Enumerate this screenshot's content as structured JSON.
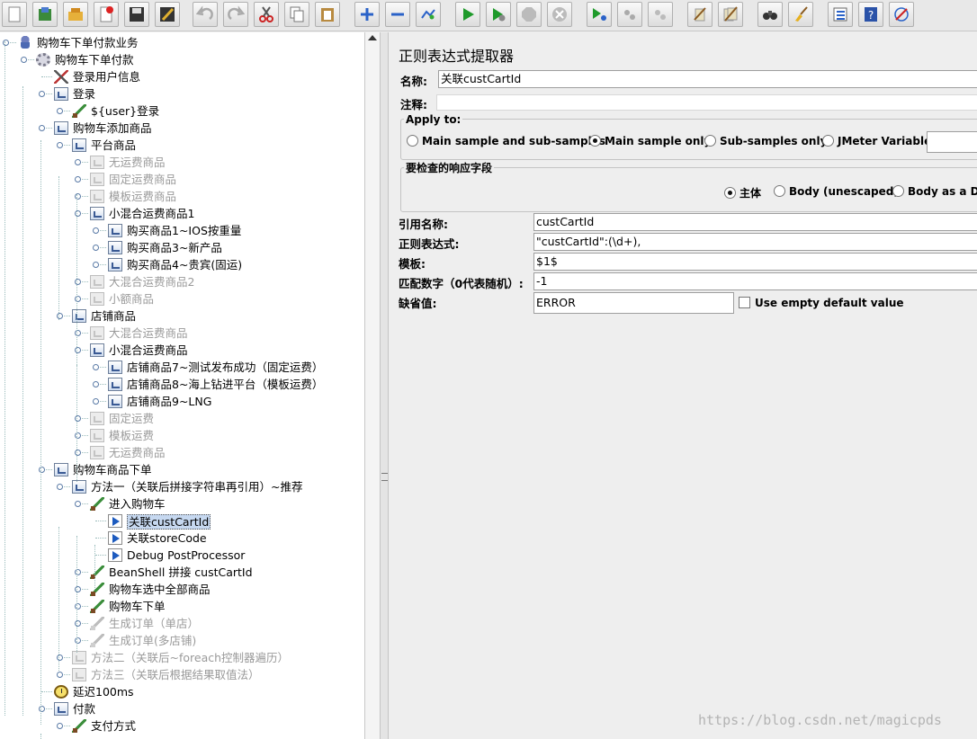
{
  "tree": {
    "nodes": [
      {
        "label": "购物车下单付款业务",
        "icon": "flask-icon",
        "state": "enabled"
      },
      {
        "label": "购物车下单付款",
        "icon": "gear-icon",
        "state": "enabled"
      },
      {
        "label": "登录用户信息",
        "icon": "tools-icon",
        "state": "enabled"
      },
      {
        "label": "登录",
        "icon": "transaction-icon",
        "state": "enabled"
      },
      {
        "label": "${user}登录",
        "icon": "sampler-icon",
        "state": "enabled"
      },
      {
        "label": "购物车添加商品",
        "icon": "transaction-icon",
        "state": "enabled"
      },
      {
        "label": "平台商品",
        "icon": "transaction-icon",
        "state": "enabled"
      },
      {
        "label": "无运费商品",
        "icon": "transaction-icon",
        "state": "disabled"
      },
      {
        "label": "固定运费商品",
        "icon": "transaction-icon",
        "state": "disabled"
      },
      {
        "label": "模板运费商品",
        "icon": "transaction-icon",
        "state": "disabled"
      },
      {
        "label": "小混合运费商品1",
        "icon": "transaction-icon",
        "state": "enabled"
      },
      {
        "label": "购买商品1~IOS按重量",
        "icon": "transaction-icon",
        "state": "enabled"
      },
      {
        "label": "购买商品3~新产品",
        "icon": "transaction-icon",
        "state": "enabled"
      },
      {
        "label": "购买商品4~贵宾(固运)",
        "icon": "transaction-icon",
        "state": "enabled"
      },
      {
        "label": "大混合运费商品2",
        "icon": "transaction-icon",
        "state": "disabled"
      },
      {
        "label": "小额商品",
        "icon": "transaction-icon",
        "state": "disabled"
      },
      {
        "label": "店铺商品",
        "icon": "transaction-icon",
        "state": "enabled"
      },
      {
        "label": "大混合运费商品",
        "icon": "transaction-icon",
        "state": "disabled"
      },
      {
        "label": "小混合运费商品",
        "icon": "transaction-icon",
        "state": "enabled"
      },
      {
        "label": "店铺商品7~测试发布成功（固定运费）",
        "icon": "transaction-icon",
        "state": "enabled"
      },
      {
        "label": "店铺商品8~海上钻进平台（模板运费）",
        "icon": "transaction-icon",
        "state": "enabled"
      },
      {
        "label": "店铺商品9~LNG",
        "icon": "transaction-icon",
        "state": "enabled"
      },
      {
        "label": "固定运费",
        "icon": "transaction-icon",
        "state": "disabled"
      },
      {
        "label": "模板运费",
        "icon": "transaction-icon",
        "state": "disabled"
      },
      {
        "label": "无运费商品",
        "icon": "transaction-icon",
        "state": "disabled"
      },
      {
        "label": "购物车商品下单",
        "icon": "transaction-icon",
        "state": "enabled"
      },
      {
        "label": "方法一（关联后拼接字符串再引用）~推荐",
        "icon": "transaction-icon",
        "state": "enabled"
      },
      {
        "label": "进入购物车",
        "icon": "sampler-icon",
        "state": "enabled"
      },
      {
        "label": "关联custCartId",
        "icon": "postprocessor-icon",
        "state": "selected"
      },
      {
        "label": "关联storeCode",
        "icon": "postprocessor-icon",
        "state": "enabled"
      },
      {
        "label": "Debug PostProcessor",
        "icon": "postprocessor-icon",
        "state": "enabled"
      },
      {
        "label": "BeanShell 拼接 custCartId",
        "icon": "sampler-icon",
        "state": "enabled"
      },
      {
        "label": "购物车选中全部商品",
        "icon": "sampler-icon",
        "state": "enabled"
      },
      {
        "label": "购物车下单",
        "icon": "sampler-icon",
        "state": "enabled"
      },
      {
        "label": "生成订单（单店）",
        "icon": "sampler-icon",
        "state": "disabled"
      },
      {
        "label": "生成订单(多店铺)",
        "icon": "sampler-icon",
        "state": "disabled"
      },
      {
        "label": "方法二（关联后~foreach控制器遍历）",
        "icon": "transaction-icon",
        "state": "disabled"
      },
      {
        "label": "方法三（关联后根据结果取值法）",
        "icon": "transaction-icon",
        "state": "disabled"
      },
      {
        "label": "延迟100ms",
        "icon": "timer-icon",
        "state": "enabled"
      },
      {
        "label": "付款",
        "icon": "transaction-icon",
        "state": "enabled"
      },
      {
        "label": "支付方式",
        "icon": "sampler-icon",
        "state": "enabled"
      }
    ]
  },
  "editor": {
    "title": "正则表达式提取器",
    "name_label": "名称:",
    "name_value": "关联custCartId",
    "comment_label": "注释:",
    "comment_value": "",
    "apply_to": {
      "title": "Apply to:",
      "options": [
        "Main sample and sub-samples",
        "Main sample only",
        "Sub-samples only",
        "JMeter Variable"
      ],
      "selected": "Main sample only",
      "variable_value": ""
    },
    "response_field": {
      "title": "要检查的响应字段",
      "options": [
        "主体",
        "Body (unescaped)",
        "Body as a Doc"
      ],
      "selected": "主体"
    },
    "ref_name_label": "引用名称:",
    "ref_name_value": "custCartId",
    "regex_label": "正则表达式:",
    "regex_value": "\"custCartId\":(\\d+),",
    "template_label": "模板:",
    "template_value": "$1$",
    "match_no_label": "匹配数字（0代表随机）:",
    "match_no_value": "-1",
    "default_label": "缺省值:",
    "default_value": "ERROR",
    "use_empty_label": "Use empty default value",
    "use_empty_checked": false
  },
  "watermark": "https://blog.csdn.net/magicpds",
  "colors": {
    "selection": "#c6d8f0",
    "disabled_text": "#9a9a9a",
    "panel_bg": "#eeeeee"
  }
}
